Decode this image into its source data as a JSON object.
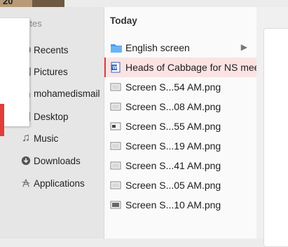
{
  "window": {
    "top_label": "20"
  },
  "sidebar": {
    "heading": "orites",
    "items": [
      {
        "label": "Recents",
        "icon": "clock-icon"
      },
      {
        "label": "Pictures",
        "icon": "pictures-icon"
      },
      {
        "label": "mohamedismail",
        "icon": "home-icon"
      },
      {
        "label": "Desktop",
        "icon": "desktop-icon"
      },
      {
        "label": "Music",
        "icon": "music-icon"
      },
      {
        "label": "Downloads",
        "icon": "downloads-icon"
      },
      {
        "label": "Applications",
        "icon": "applications-icon"
      }
    ]
  },
  "column": {
    "heading": "Today",
    "rows": [
      {
        "label": "English screen",
        "icon": "folder-icon",
        "chevron": "▶"
      },
      {
        "label": "Heads of Cabbage for NS meeting.doc",
        "icon": "word-doc-icon"
      },
      {
        "label": "Screen S...54 AM.png",
        "icon": "image-file-icon"
      },
      {
        "label": "Screen S...08 AM.png",
        "icon": "image-file-icon"
      },
      {
        "label": "Screen S...55 AM.png",
        "icon": "image-file-icon"
      },
      {
        "label": "Screen S...19 AM.png",
        "icon": "image-file-icon"
      },
      {
        "label": "Screen S...41 AM.png",
        "icon": "image-file-icon"
      },
      {
        "label": "Screen S...05 AM.png",
        "icon": "image-file-icon"
      },
      {
        "label": "Screen S...10 AM.png",
        "icon": "image-file-icon"
      }
    ]
  },
  "colors": {
    "folder_blue": "#4a9fe8",
    "highlight_red": "#e43b3b",
    "word_blue": "#2b5fb8"
  }
}
